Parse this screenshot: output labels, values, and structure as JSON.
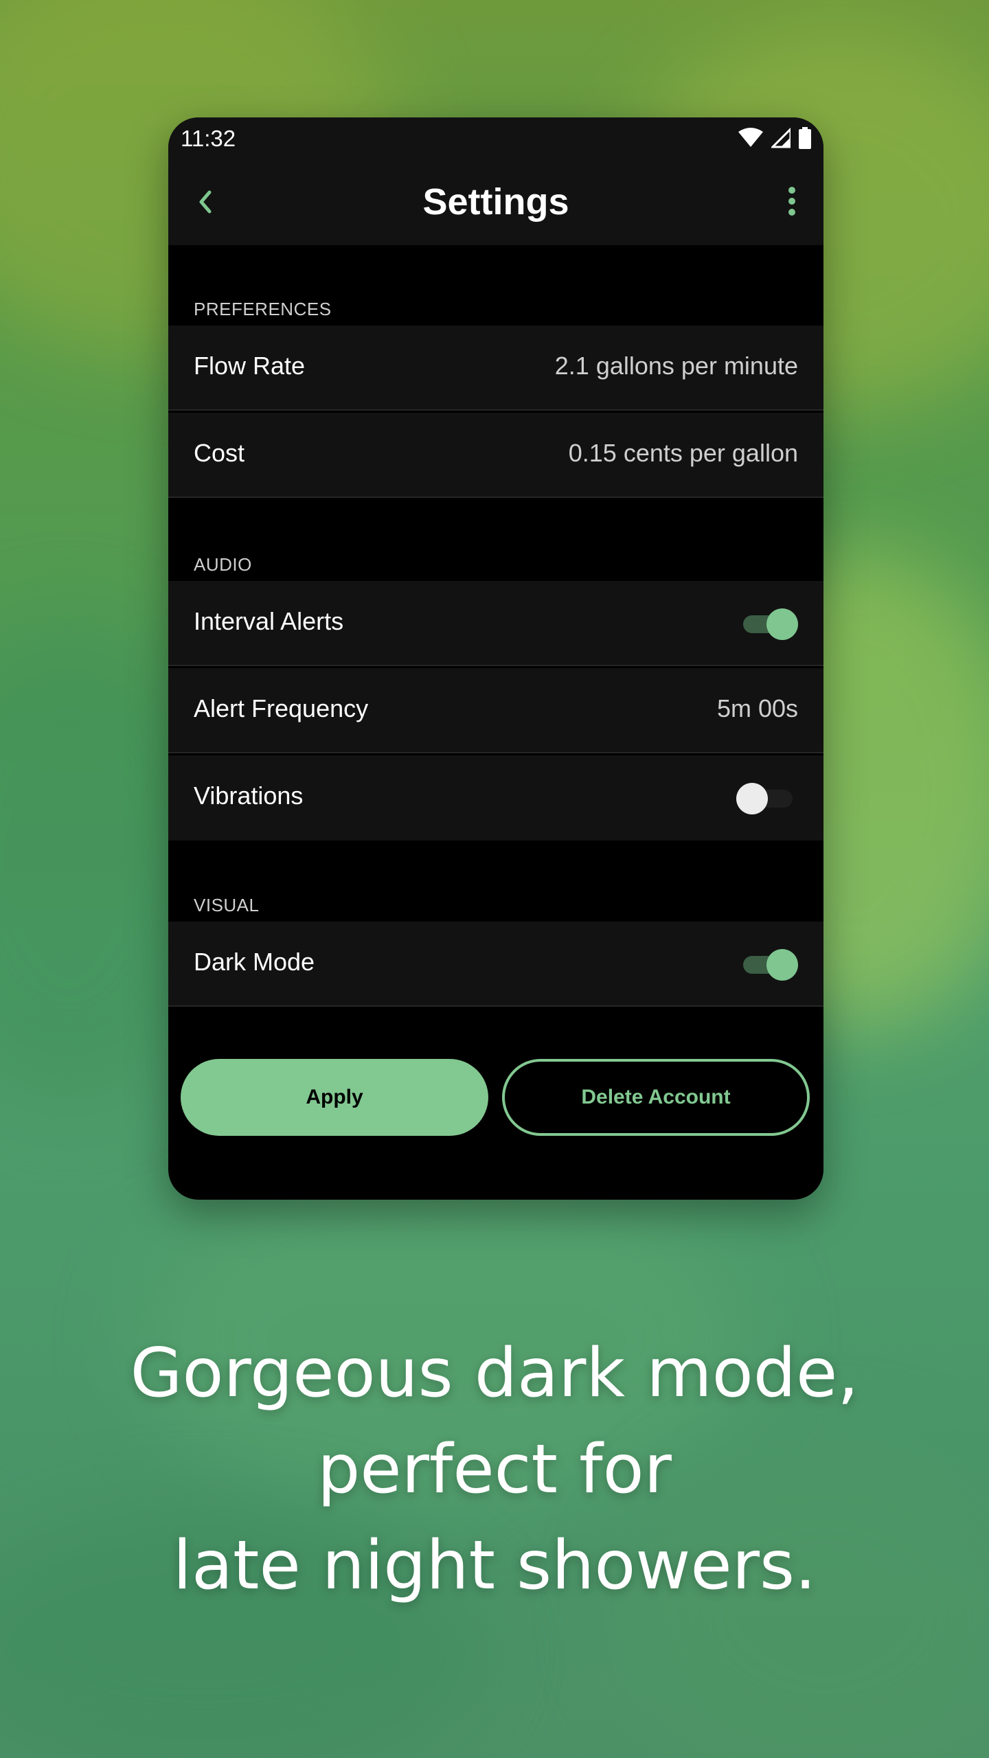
{
  "status_bar": {
    "time": "11:32",
    "icons": [
      "wifi-icon",
      "signal-icon",
      "battery-icon"
    ]
  },
  "app_bar": {
    "title": "Settings",
    "back_icon": "chevron-left-icon",
    "menu_icon": "more-vertical-icon"
  },
  "sections": {
    "preferences": {
      "header": "PREFERENCES",
      "flow_rate": {
        "label": "Flow Rate",
        "value": "2.1 gallons per minute"
      },
      "cost": {
        "label": "Cost",
        "value": "0.15 cents per gallon"
      }
    },
    "audio": {
      "header": "AUDIO",
      "interval_alerts": {
        "label": "Interval Alerts",
        "enabled": true
      },
      "alert_frequency": {
        "label": "Alert Frequency",
        "value": "5m 00s"
      },
      "vibrations": {
        "label": "Vibrations",
        "enabled": false
      }
    },
    "visual": {
      "header": "VISUAL",
      "dark_mode": {
        "label": "Dark Mode",
        "enabled": true
      }
    }
  },
  "buttons": {
    "apply": "Apply",
    "delete_account": "Delete Account"
  },
  "tagline": {
    "line1": "Gorgeous dark mode,",
    "line2": "perfect for",
    "line3": "late night showers."
  },
  "colors": {
    "accent": "#82c891",
    "surface": "#121212",
    "background": "#000000"
  }
}
